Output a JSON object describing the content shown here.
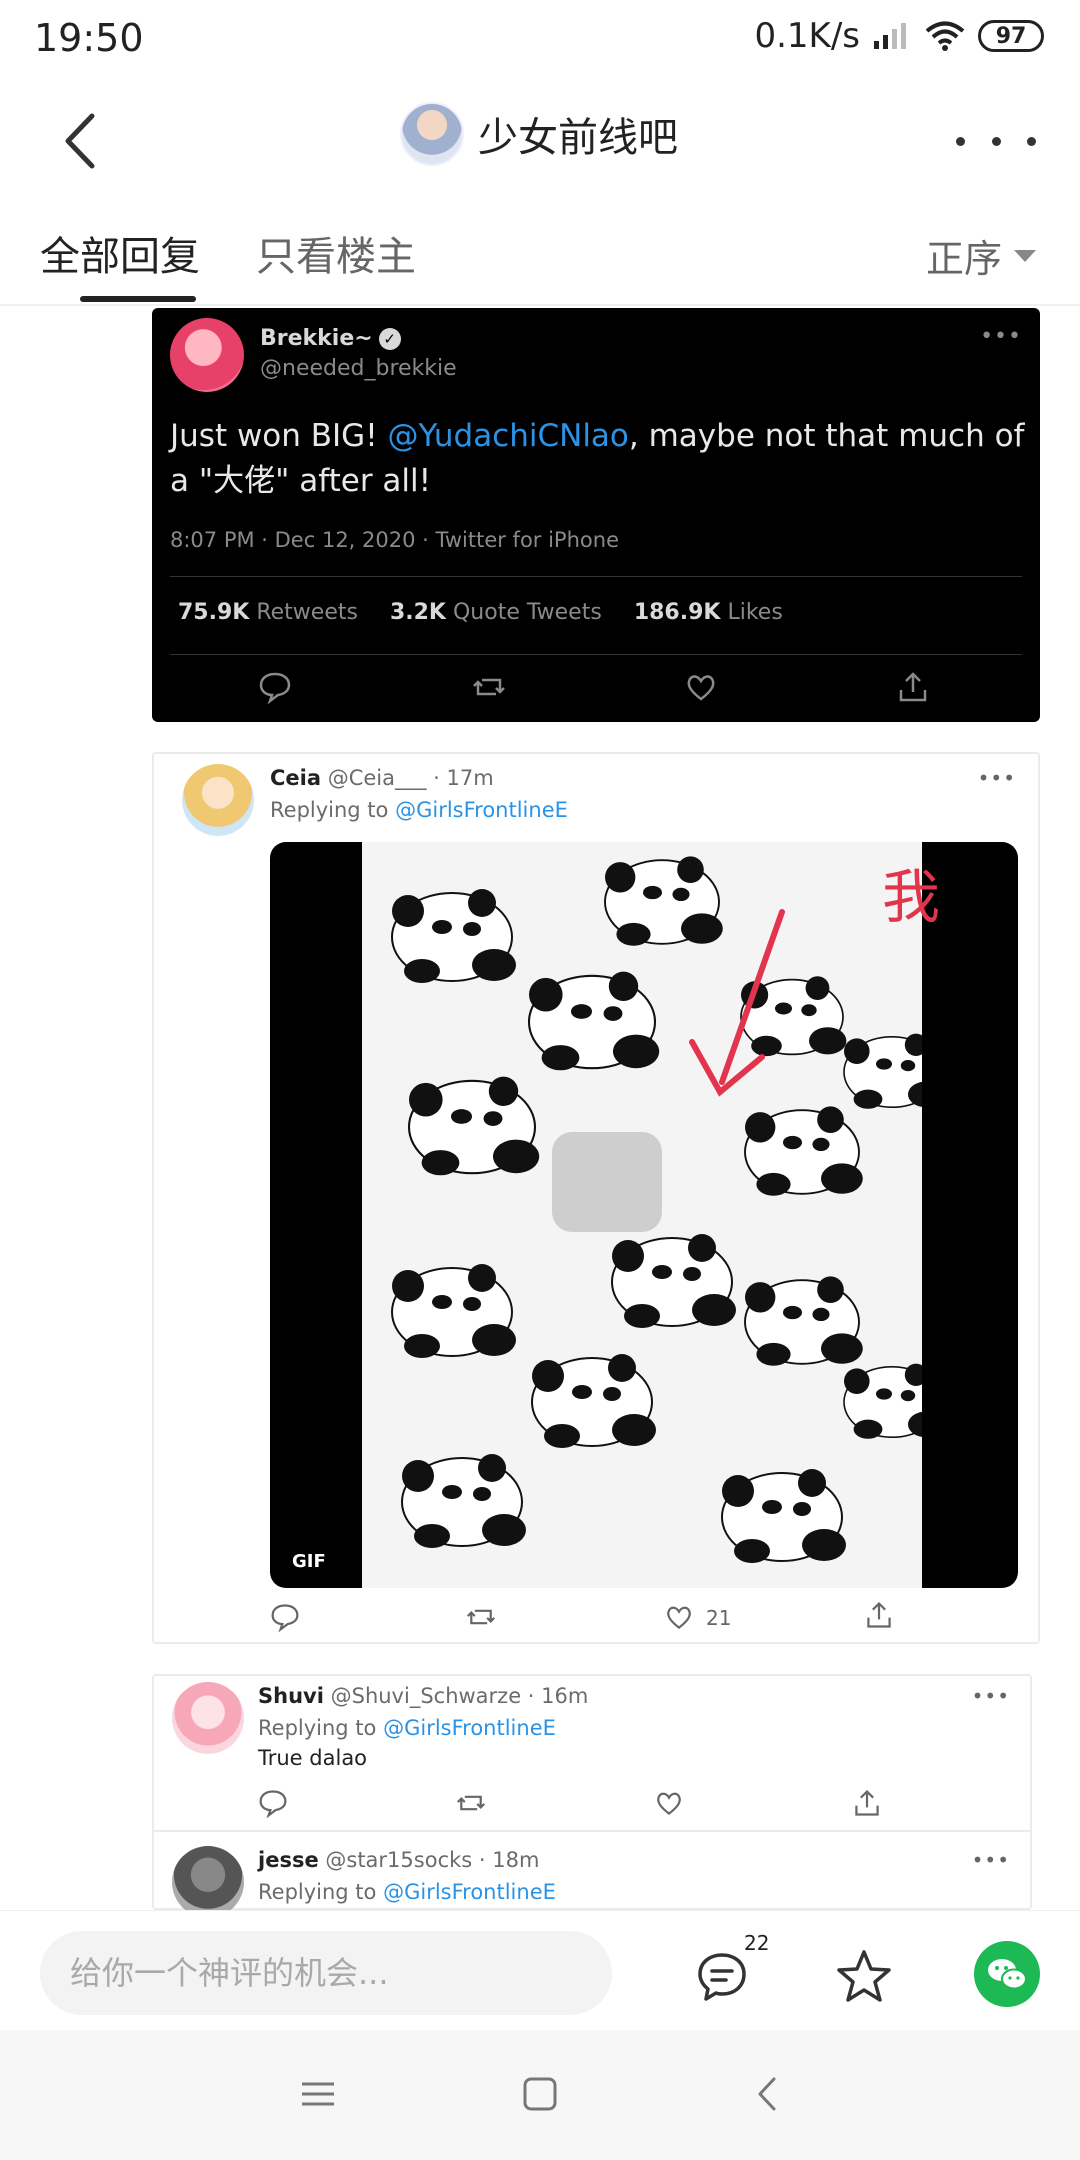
{
  "status_bar": {
    "time": "19:50",
    "net_speed": "0.1K/s",
    "battery": "97"
  },
  "header": {
    "title": "少女前线吧"
  },
  "tabs": {
    "all_replies": "全部回复",
    "only_op": "只看楼主",
    "sort": "正序"
  },
  "main_tweet": {
    "name": "Brekkie~",
    "handle": "@needed_brekkie",
    "body_pre": "Just won BIG! ",
    "body_mention": "@YudachiCNlao",
    "body_post": ", maybe not that much of a \"大佬\" after all!",
    "meta": "8:07 PM · Dec 12, 2020 · Twitter for iPhone",
    "retweets_count": "75.9K",
    "retweets_label": "Retweets",
    "quotes_count": "3.2K",
    "quotes_label": "Quote Tweets",
    "likes_count": "186.9K",
    "likes_label": "Likes"
  },
  "replies": [
    {
      "name": "Ceia",
      "handle_time": "@Ceia___ · 17m",
      "replying_label": "Replying to",
      "replying_to": "@GirlsFrontlineE",
      "gif_label": "GIF",
      "gif_overlay_char": "我",
      "likes": "21"
    },
    {
      "name": "Shuvi",
      "handle_time": "@Shuvi_Schwarze · 16m",
      "replying_label": "Replying to",
      "replying_to": "@GirlsFrontlineE",
      "text": "True dalao"
    },
    {
      "name": "jesse",
      "handle_time": "@star15socks · 18m",
      "replying_label": "Replying to",
      "replying_to": "@GirlsFrontlineE"
    }
  ],
  "bottom_bar": {
    "placeholder": "给你一个神评的机会...",
    "reply_count": "22"
  },
  "colors": {
    "accent_link": "#2b93e6",
    "wechat": "#1db954"
  }
}
